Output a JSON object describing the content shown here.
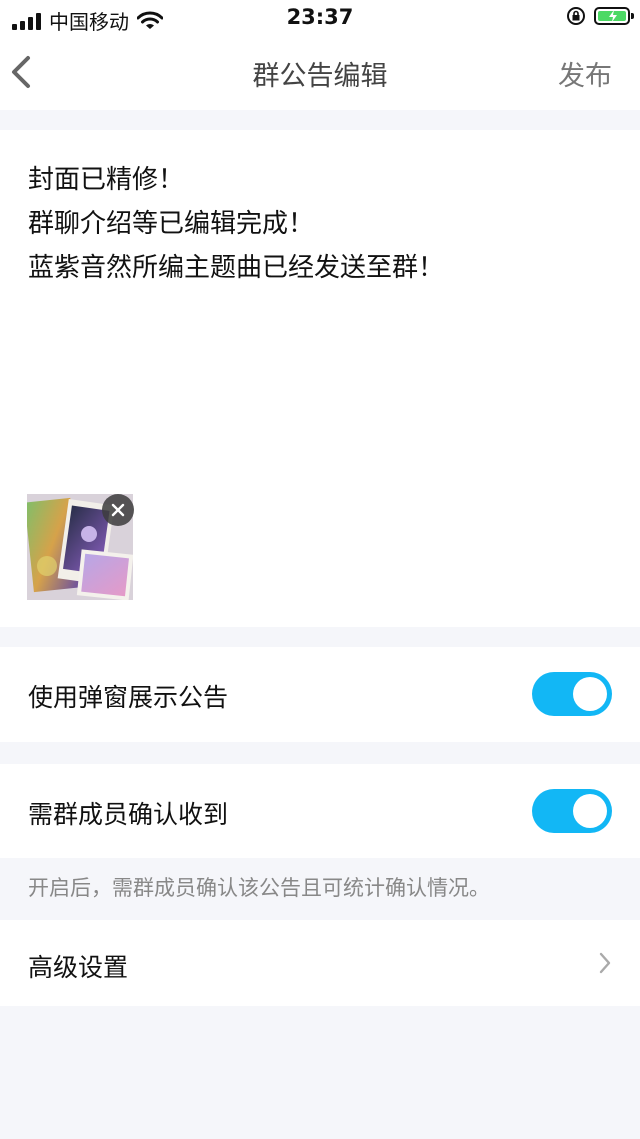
{
  "status_bar": {
    "carrier": "中国移动",
    "time": "23:37"
  },
  "nav": {
    "title": "群公告编辑",
    "publish_label": "发布"
  },
  "announcement": {
    "lines": [
      "封面已精修！",
      "群聊介绍等已编辑完成！",
      "蓝紫音然所编主题曲已经发送至群！"
    ]
  },
  "settings": {
    "popup_label": "使用弹窗展示公告",
    "popup_enabled": true,
    "confirm_label": "需群成员确认收到",
    "confirm_enabled": true,
    "confirm_hint": "开启后，需群成员确认该公告且可统计确认情况。",
    "advanced_label": "高级设置"
  },
  "colors": {
    "accent": "#12b7f5",
    "battery": "#4cd964",
    "background": "#f5f6fa"
  }
}
